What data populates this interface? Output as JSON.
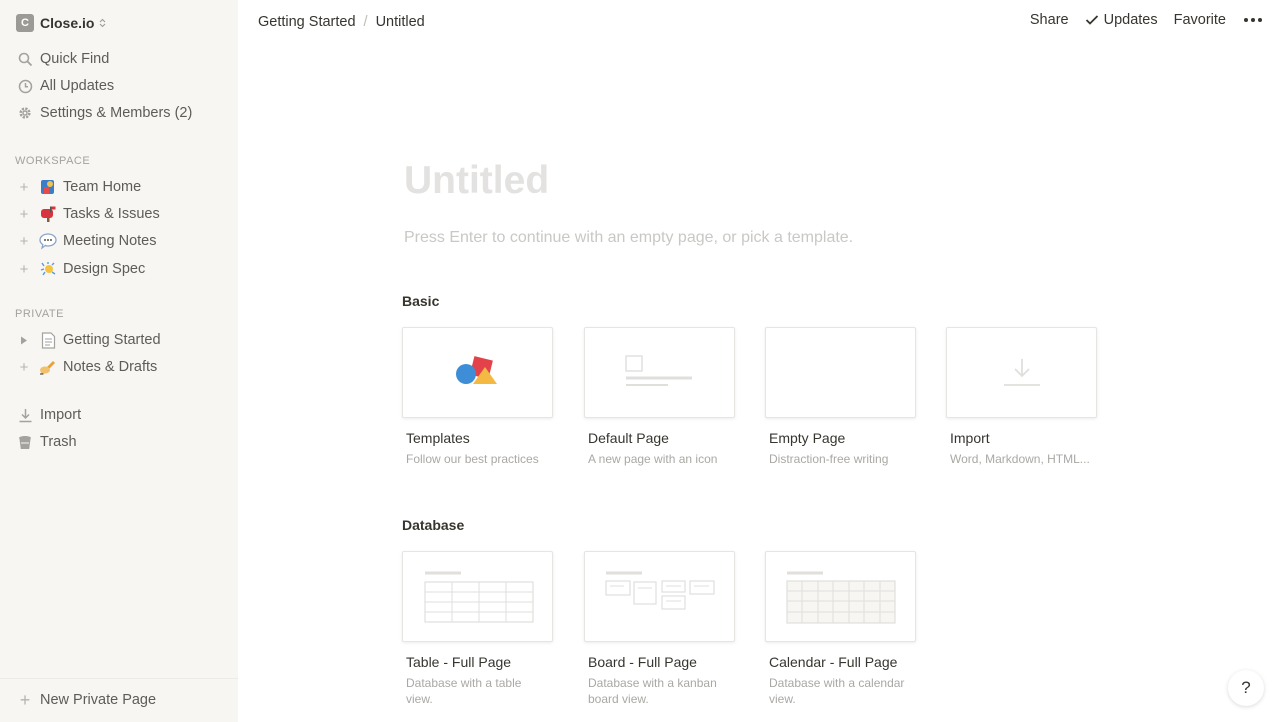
{
  "workspace": {
    "name": "Close.io",
    "logo_letter": "C"
  },
  "sidebar": {
    "nav": [
      {
        "label": "Quick Find",
        "icon": "search-icon"
      },
      {
        "label": "All Updates",
        "icon": "clock-icon"
      },
      {
        "label": "Settings & Members (2)",
        "icon": "gear-icon"
      }
    ],
    "workspace_label": "WORKSPACE",
    "workspace_pages": [
      {
        "label": "Team Home",
        "icon": "team-home-emoji"
      },
      {
        "label": "Tasks & Issues",
        "icon": "mailbox-emoji"
      },
      {
        "label": "Meeting Notes",
        "icon": "speech-bubble-emoji"
      },
      {
        "label": "Design Spec",
        "icon": "sparkle-emoji"
      }
    ],
    "private_label": "PRIVATE",
    "private_pages": [
      {
        "label": "Getting Started",
        "icon": "document-icon"
      },
      {
        "label": "Notes & Drafts",
        "icon": "writing-hand-emoji"
      }
    ],
    "tools": [
      {
        "label": "Import",
        "icon": "import-icon"
      },
      {
        "label": "Trash",
        "icon": "trash-icon"
      }
    ],
    "new_page_label": "New Private Page"
  },
  "topbar": {
    "breadcrumb": [
      "Getting Started",
      "Untitled"
    ],
    "share_label": "Share",
    "updates_label": "Updates",
    "favorite_label": "Favorite"
  },
  "main": {
    "title_placeholder": "Untitled",
    "hint": "Press Enter to continue with an empty page, or pick a template.",
    "basic_label": "Basic",
    "basic_cards": [
      {
        "title": "Templates",
        "desc": "Follow our best practices"
      },
      {
        "title": "Default Page",
        "desc": "A new page with an icon"
      },
      {
        "title": "Empty Page",
        "desc": "Distraction-free writing"
      },
      {
        "title": "Import",
        "desc": "Word, Markdown, HTML..."
      }
    ],
    "database_label": "Database",
    "database_cards": [
      {
        "title": "Table - Full Page",
        "desc": "Database with a table view."
      },
      {
        "title": "Board - Full Page",
        "desc": "Database with a kanban board view."
      },
      {
        "title": "Calendar - Full Page",
        "desc": "Database with a calendar view."
      }
    ]
  },
  "help_label": "?",
  "colors": {
    "sidebar_bg": "#f7f6f3",
    "text": "#37352f",
    "muted": "#a9a8a5"
  }
}
